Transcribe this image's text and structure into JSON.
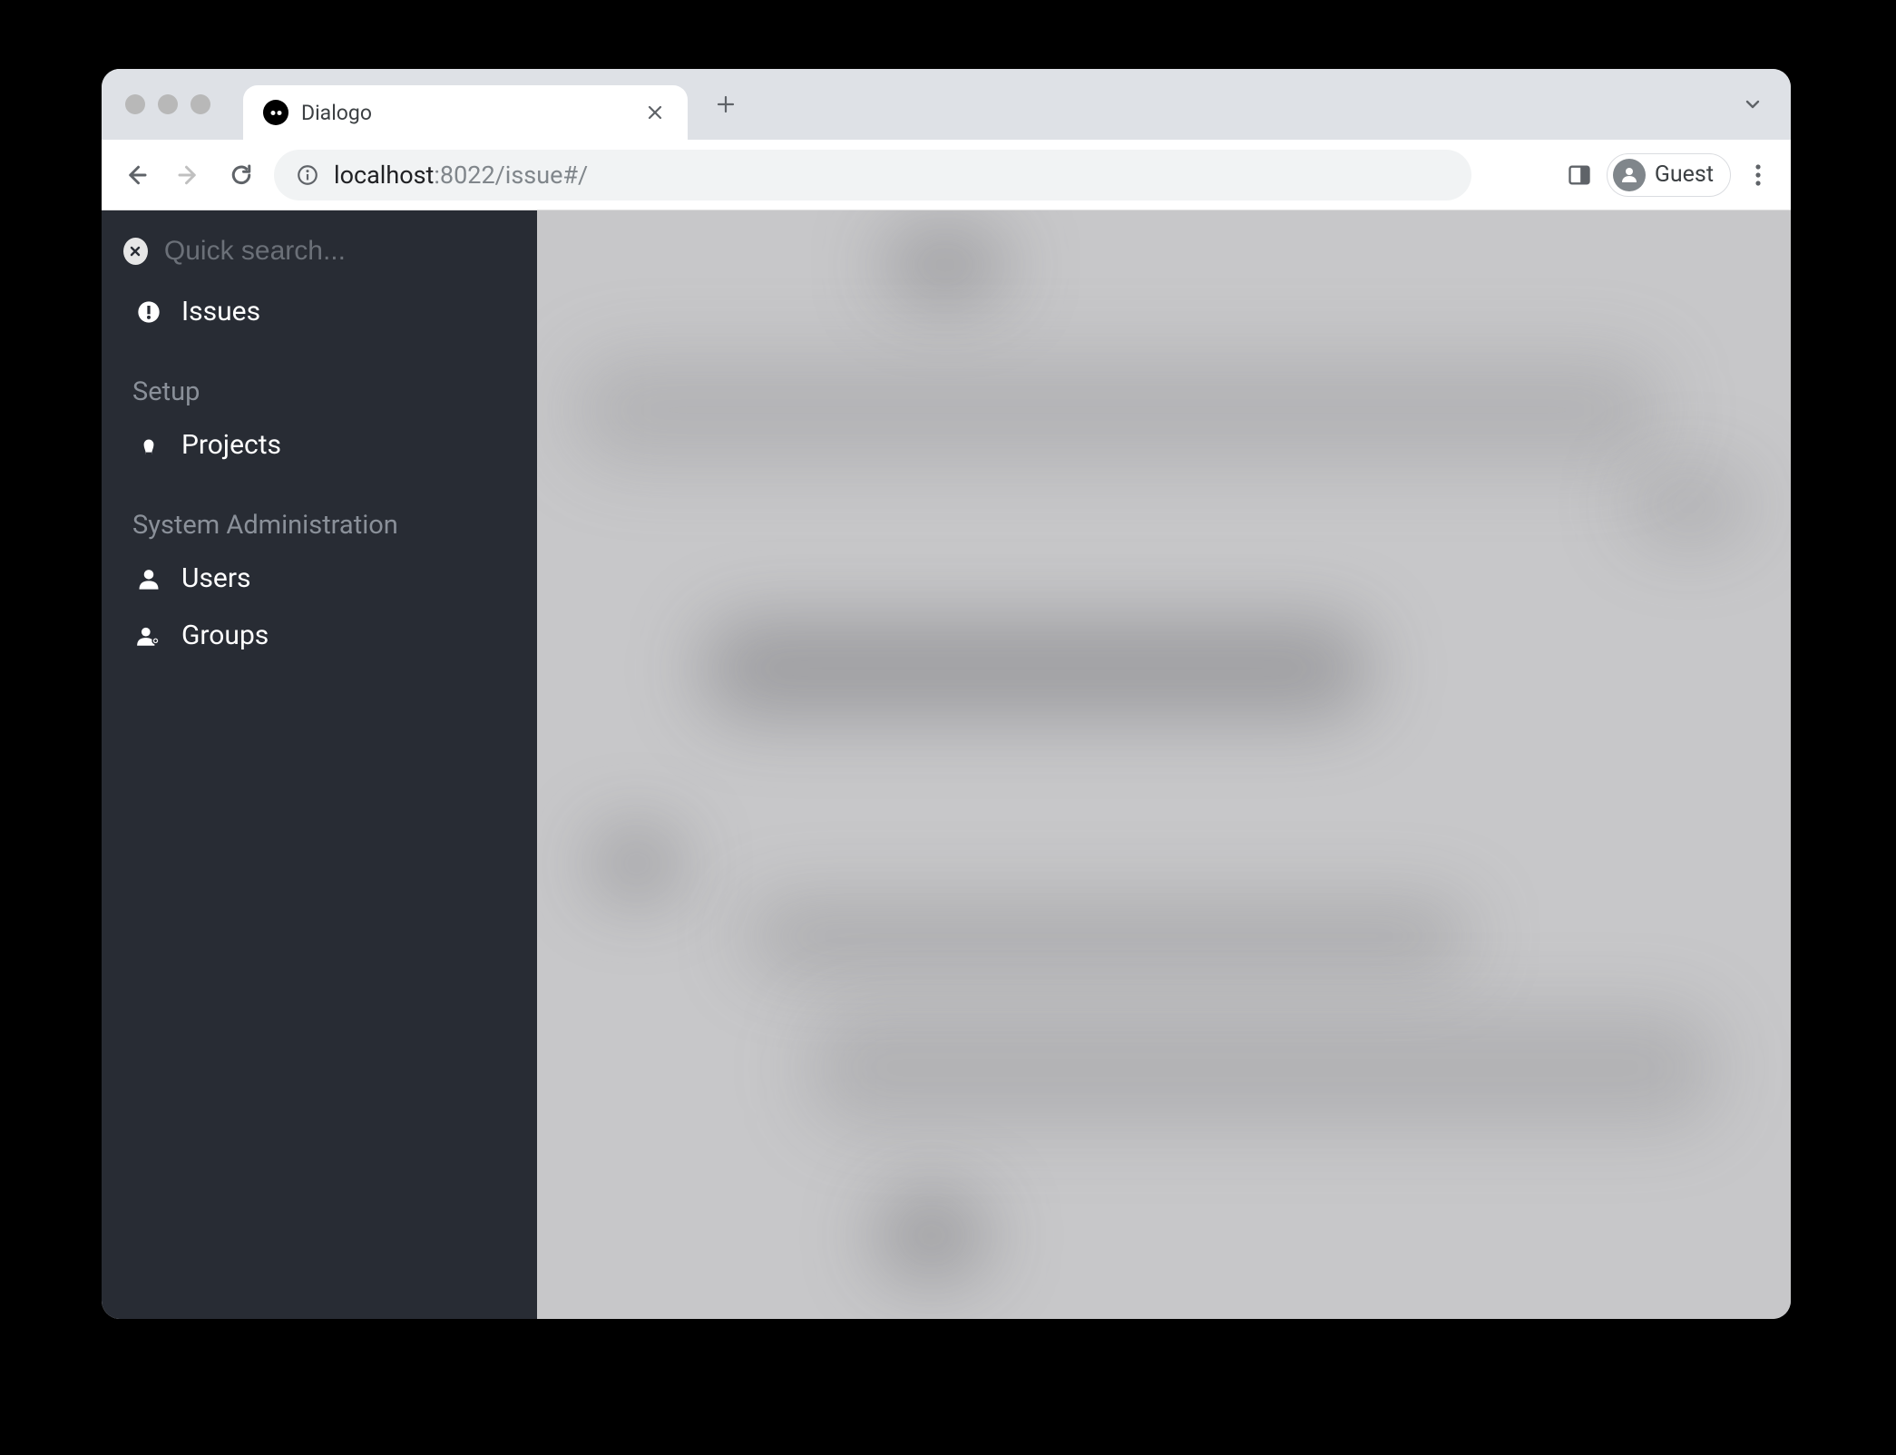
{
  "browser": {
    "tab_title": "Dialogo",
    "url_host": "localhost",
    "url_port_path": ":8022/issue#/",
    "guest_label": "Guest"
  },
  "sidebar": {
    "search_placeholder": "Quick search...",
    "items_main": [
      {
        "label": "Issues"
      }
    ],
    "section_setup_label": "Setup",
    "items_setup": [
      {
        "label": "Projects"
      }
    ],
    "section_admin_label": "System Administration",
    "items_admin": [
      {
        "label": "Users"
      },
      {
        "label": "Groups"
      }
    ]
  }
}
